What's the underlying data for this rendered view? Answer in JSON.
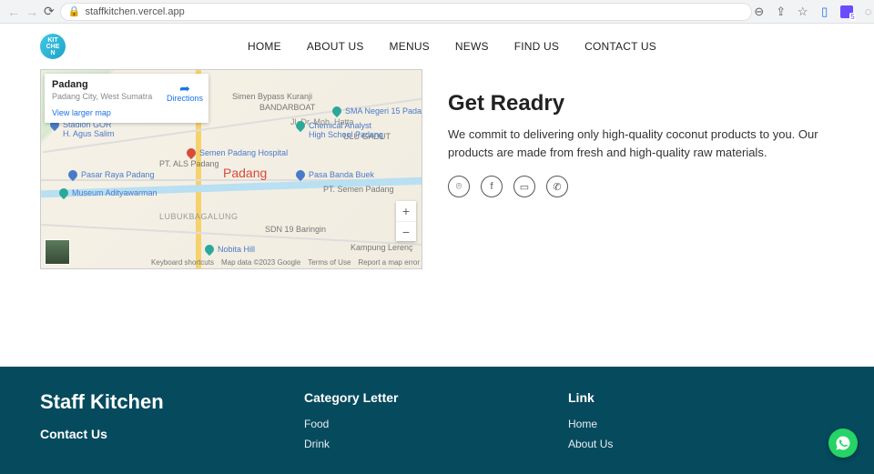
{
  "browser": {
    "url": "staffkitchen.vercel.app"
  },
  "nav": {
    "items": [
      "HOME",
      "ABOUT US",
      "MENUS",
      "NEWS",
      "FIND US",
      "CONTACT US"
    ],
    "logo_text": "KIT\nCHE\nN"
  },
  "map": {
    "info": {
      "title": "Padang",
      "subtitle": "Padang City, West Sumatra",
      "view_larger": "View larger map",
      "directions": "Directions"
    },
    "city_label": "Padang",
    "pois": {
      "stadion": "Stadion GOR\nH. Agus Salim",
      "pasar_raya": "Pasar Raya Padang",
      "museum": "Museum Adityawarman",
      "lubuk": "LUBUKBAGALUNG",
      "pt_als": "PT. ALS Padang",
      "semen_hospital": "Semen Padang Hospital",
      "chemical": "Chemical Analyst\nHigh School Padang",
      "sma": "SMA Negeri 15 Padang",
      "bypass": "Simen Bypass Kuranji",
      "bandar": "BANDARBOAT",
      "ulu": "ULU GADUT",
      "basa": "Pasa Banda Buek",
      "pt_semen": "PT. Semen Padang",
      "sdn": "SDN 19 Baringin",
      "nobita": "Nobita Hill",
      "kampung": "Kampung Lerenç",
      "moh": "Jl. Dr. Moh. Hatta"
    },
    "zoom_in": "+",
    "zoom_out": "−",
    "attrib": {
      "shortcuts": "Keyboard shortcuts",
      "data": "Map data ©2023 Google",
      "terms": "Terms of Use",
      "report": "Report a map error"
    }
  },
  "section": {
    "heading": "Get Readry",
    "body": "We commit to delivering only high-quality coconut products to you. Our products are made from fresh and high-quality raw materials."
  },
  "footer": {
    "brand": "Staff Kitchen",
    "contact_heading": "Contact Us",
    "cat_heading": "Category Letter",
    "cat_items": [
      "Food",
      "Drink"
    ],
    "link_heading": "Link",
    "link_items": [
      "Home",
      "About Us"
    ]
  }
}
